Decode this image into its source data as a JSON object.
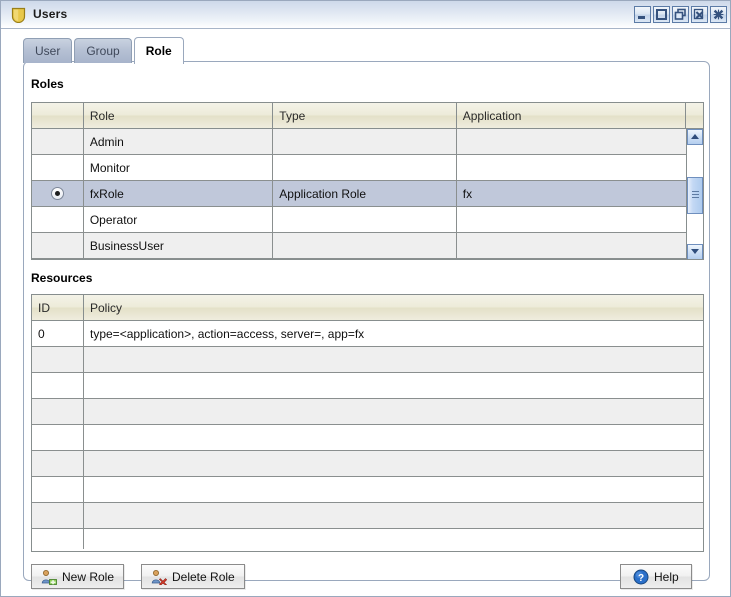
{
  "window": {
    "title": "Users",
    "icon": "shield-icon",
    "controls": [
      {
        "name": "minimize-button",
        "icon": "minimize-icon",
        "label": "Minimize"
      },
      {
        "name": "maximize-button",
        "icon": "maximize-icon",
        "label": "Maximize"
      },
      {
        "name": "restore-button",
        "icon": "restore-icon",
        "label": "Restore"
      },
      {
        "name": "close-view-button",
        "icon": "close-document-icon",
        "label": "Close"
      },
      {
        "name": "close-window-button",
        "icon": "close-window-icon",
        "label": "Close Window"
      }
    ]
  },
  "tabs": [
    {
      "label": "User",
      "active": false
    },
    {
      "label": "Group",
      "active": false
    },
    {
      "label": "Role",
      "active": true
    }
  ],
  "roles_section": {
    "label": "Roles",
    "columns": [
      "",
      "Role",
      "Type",
      "Application"
    ],
    "rows": [
      {
        "selected": false,
        "role": "Admin",
        "type": "",
        "application": ""
      },
      {
        "selected": false,
        "role": "Monitor",
        "type": "",
        "application": ""
      },
      {
        "selected": true,
        "role": "fxRole",
        "type": "Application Role",
        "application": "fx"
      },
      {
        "selected": false,
        "role": "Operator",
        "type": "",
        "application": ""
      },
      {
        "selected": false,
        "role": "BusinessUser",
        "type": "",
        "application": ""
      }
    ],
    "scrollbar": {
      "up_arrow": "triangle-up-icon",
      "down_arrow": "triangle-down-icon",
      "thumb_top_pct": 32,
      "thumb_height_pct": 38
    }
  },
  "resources_section": {
    "label": "Resources",
    "columns": [
      "ID",
      "Policy"
    ],
    "rows": [
      {
        "id": "0",
        "policy": "type=<application>, action=access, server=, app=fx"
      },
      {
        "id": "",
        "policy": ""
      },
      {
        "id": "",
        "policy": ""
      },
      {
        "id": "",
        "policy": ""
      },
      {
        "id": "",
        "policy": ""
      },
      {
        "id": "",
        "policy": ""
      },
      {
        "id": "",
        "policy": ""
      },
      {
        "id": "",
        "policy": ""
      },
      {
        "id": "",
        "policy": ""
      }
    ]
  },
  "footer": {
    "new_role_label": "New Role",
    "new_role_icon": "user-add-icon",
    "delete_role_label": "Delete Role",
    "delete_role_icon": "user-delete-icon",
    "help_label": "Help",
    "help_icon": "help-question-icon"
  },
  "colors": {
    "titlebar_top": "#ced9ea",
    "tab_active_bg": "#ffffff",
    "tab_inactive_bg": "#b6c1d4",
    "table_header": "#ebe8d6",
    "row_alt": "#efefef",
    "row_selected": "#c0c8da",
    "scrollbar_accent": "#aecbee",
    "shield_icon": "#e8c84a",
    "add_accent": "#7bc043",
    "delete_accent": "#d93b2b",
    "help_accent": "#2a6fc9",
    "border": "#878e8e"
  }
}
